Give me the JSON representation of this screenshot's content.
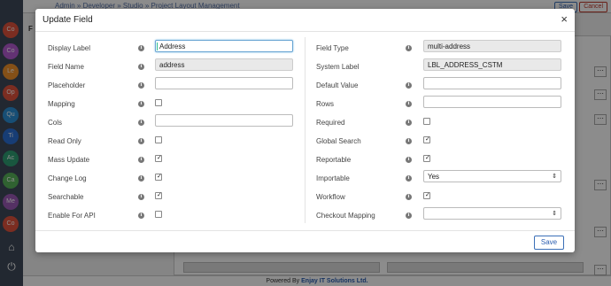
{
  "app": {
    "rail_items": [
      {
        "label": "Co",
        "color": "#e0533d"
      },
      {
        "label": "Co",
        "color": "#b45bd1"
      },
      {
        "label": "Le",
        "color": "#f0922a"
      },
      {
        "label": "Op",
        "color": "#e0533d"
      },
      {
        "label": "Qu",
        "color": "#2a8fd6"
      },
      {
        "label": "Ti",
        "color": "#2a6fd6"
      },
      {
        "label": "Ac",
        "color": "#2f9f73"
      },
      {
        "label": "Ca",
        "color": "#58b35a"
      },
      {
        "label": "Me",
        "color": "#9b59b6"
      },
      {
        "label": "Co",
        "color": "#e0533d"
      }
    ],
    "home_icon": "home-icon",
    "power_icon": "power-icon"
  },
  "background": {
    "breadcrumb": "Admin » Developer » Studio » Project Layout Management",
    "save_label": "Save",
    "cancel_label": "Cancel",
    "footer_prefix": "Powered By",
    "footer_brand": "Enjay IT Solutions Ltd."
  },
  "modal": {
    "title": "Update Field",
    "close_glyph": "×",
    "save_label": "Save",
    "left": {
      "display_label": {
        "label": "Display Label",
        "value": "Address"
      },
      "field_name": {
        "label": "Field Name",
        "value": "address"
      },
      "placeholder": {
        "label": "Placeholder",
        "value": ""
      },
      "mapping": {
        "label": "Mapping",
        "checked": false
      },
      "cols": {
        "label": "Cols",
        "value": ""
      },
      "read_only": {
        "label": "Read Only",
        "checked": false
      },
      "mass_update": {
        "label": "Mass Update",
        "checked": true
      },
      "change_log": {
        "label": "Change Log",
        "checked": true
      },
      "searchable": {
        "label": "Searchable",
        "checked": true
      },
      "enable_api": {
        "label": "Enable For API",
        "checked": false
      }
    },
    "right": {
      "field_type": {
        "label": "Field Type",
        "value": "multi-address"
      },
      "system_label": {
        "label": "System Label",
        "value": "LBL_ADDRESS_CSTM"
      },
      "default_value": {
        "label": "Default Value",
        "value": ""
      },
      "rows": {
        "label": "Rows",
        "value": ""
      },
      "required": {
        "label": "Required",
        "checked": false
      },
      "global_search": {
        "label": "Global Search",
        "checked": true
      },
      "reportable": {
        "label": "Reportable",
        "checked": true
      },
      "importable": {
        "label": "Importable",
        "value": "Yes"
      },
      "workflow": {
        "label": "Workflow",
        "checked": true
      },
      "checkout_mapping": {
        "label": "Checkout Mapping",
        "value": ""
      }
    }
  }
}
